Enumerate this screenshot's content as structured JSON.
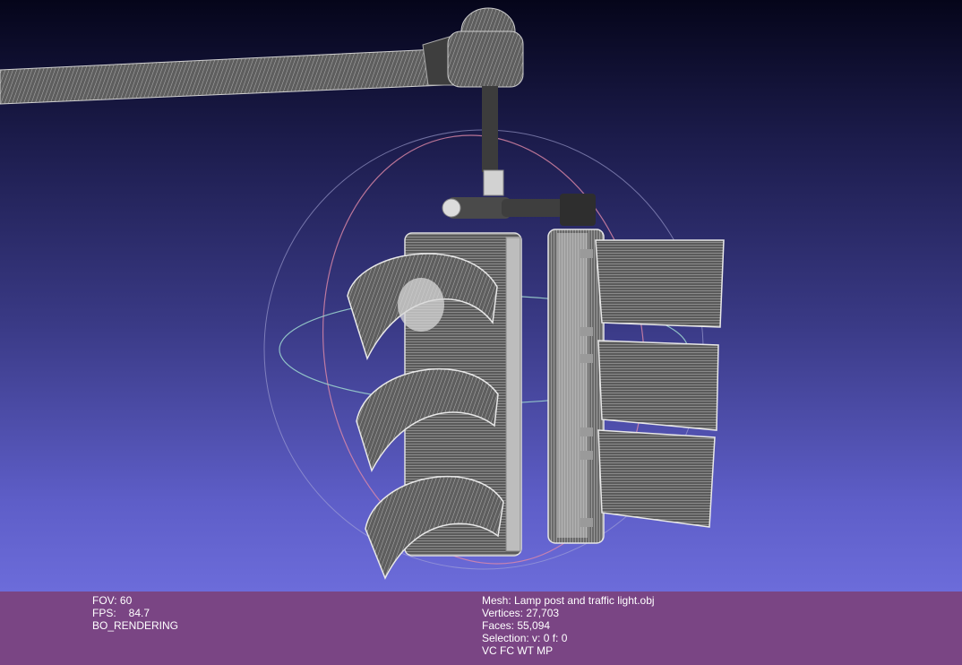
{
  "status_left": {
    "fov_label": "FOV:",
    "fov_value": "60",
    "fps_label": "FPS:",
    "fps_value": "84.7",
    "render_mode": "BO_RENDERING"
  },
  "status_right": {
    "mesh_label": "Mesh:",
    "mesh_name": "Lamp post and traffic light.obj",
    "vertices_label": "Vertices:",
    "vertices_value": "27,703",
    "faces_label": "Faces:",
    "faces_value": "55,094",
    "selection_label": "Selection:",
    "selection_value": "v: 0 f: 0",
    "flags": "VC FC WT MP"
  },
  "colors": {
    "info_bar": "#7a4584",
    "mesh_gray": "#7a7a7a",
    "trackball_red": "#e08aa8",
    "trackball_green": "#9fd8d0",
    "trackball_blue": "#a9a9d8"
  },
  "icons": {
    "trackball": "trackball-gizmo"
  }
}
